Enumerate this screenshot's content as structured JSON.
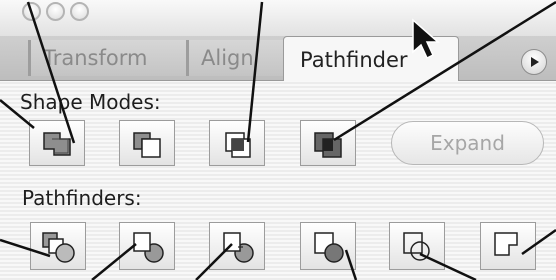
{
  "window": {
    "traffic_lights": [
      "close",
      "minimize",
      "zoom"
    ]
  },
  "tabs": [
    {
      "label": "Transform",
      "active": false
    },
    {
      "label": "Align",
      "active": false
    },
    {
      "label": "Pathfinder",
      "active": true
    }
  ],
  "panel_menu_icon": "triangle-right-icon",
  "shape_modes": {
    "label": "Shape Modes:",
    "buttons": [
      "add-to-shape-area-icon",
      "subtract-from-shape-area-icon",
      "intersect-shape-areas-icon",
      "exclude-overlapping-shape-areas-icon"
    ],
    "expand_label": "Expand",
    "expand_enabled": false
  },
  "pathfinders": {
    "label": "Pathfinders:",
    "buttons": [
      "divide-icon",
      "trim-icon",
      "merge-icon",
      "crop-icon",
      "outline-icon",
      "minus-back-icon"
    ]
  },
  "colors": {
    "background": "#f4f4f4",
    "tab_inactive_text": "#8a8a8a",
    "expand_disabled_text": "#a6a6a6"
  }
}
